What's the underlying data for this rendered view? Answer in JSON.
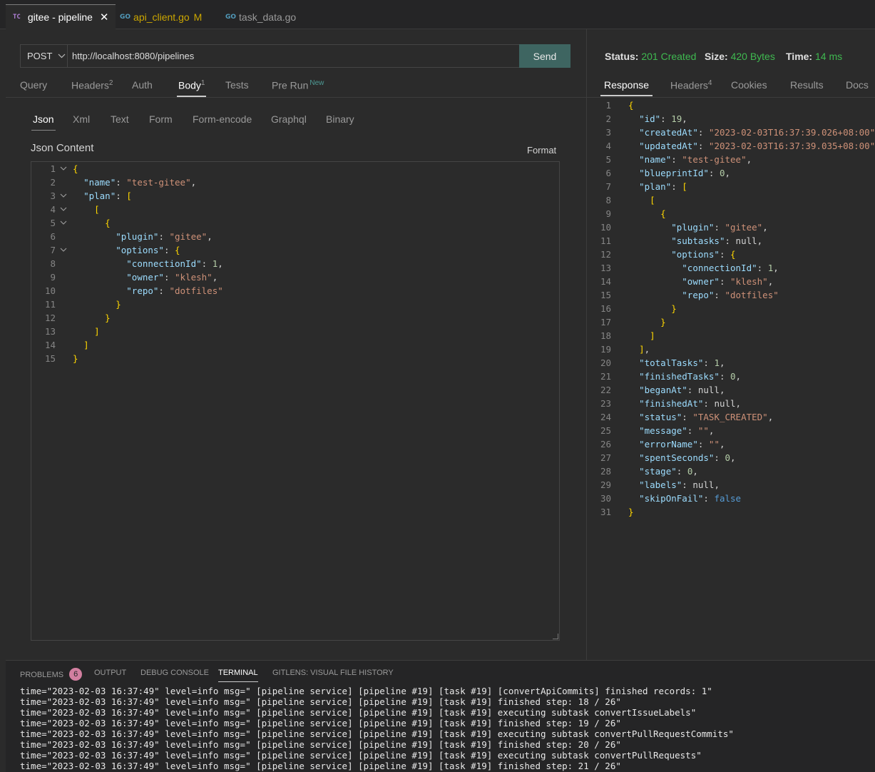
{
  "tabs": [
    {
      "label": "gitee - pipeline",
      "badge": "TC",
      "active": true
    },
    {
      "label": "api_client.go",
      "badge": "GO",
      "modified": "M"
    },
    {
      "label": "task_data.go",
      "badge": "GO"
    }
  ],
  "request": {
    "method": "POST",
    "url": "http://localhost:8080/pipelines",
    "send_label": "Send",
    "tabs": [
      {
        "label": "Query"
      },
      {
        "label": "Headers",
        "count": "2"
      },
      {
        "label": "Auth"
      },
      {
        "label": "Body",
        "count": "1",
        "active": true
      },
      {
        "label": "Tests"
      },
      {
        "label": "Pre Run",
        "tag": "New"
      }
    ],
    "body_tabs": [
      "Json",
      "Xml",
      "Text",
      "Form",
      "Form-encode",
      "Graphql",
      "Binary"
    ],
    "json_label": "Json Content",
    "format_label": "Format",
    "json_lines": [
      "{",
      "  \"name\": \"test-gitee\",",
      "  \"plan\": [",
      "    [",
      "      {",
      "        \"plugin\": \"gitee\",",
      "        \"options\": {",
      "          \"connectionId\": 1,",
      "          \"owner\": \"klesh\",",
      "          \"repo\": \"dotfiles\"",
      "        }",
      "      }",
      "    ]",
      "  ]",
      "}"
    ]
  },
  "response": {
    "status_label": "Status:",
    "status_value": "201 Created",
    "size_label": "Size:",
    "size_value": "420 Bytes",
    "time_label": "Time:",
    "time_value": "14 ms",
    "tabs": [
      {
        "label": "Response",
        "active": true
      },
      {
        "label": "Headers",
        "count": "4"
      },
      {
        "label": "Cookies"
      },
      {
        "label": "Results"
      },
      {
        "label": "Docs"
      }
    ],
    "json_lines": [
      "{",
      "  \"id\": 19,",
      "  \"createdAt\": \"2023-02-03T16:37:39.026+08:00\",",
      "  \"updatedAt\": \"2023-02-03T16:37:39.035+08:00\",",
      "  \"name\": \"test-gitee\",",
      "  \"blueprintId\": 0,",
      "  \"plan\": [",
      "    [",
      "      {",
      "        \"plugin\": \"gitee\",",
      "        \"subtasks\": null,",
      "        \"options\": {",
      "          \"connectionId\": 1,",
      "          \"owner\": \"klesh\",",
      "          \"repo\": \"dotfiles\"",
      "        }",
      "      }",
      "    ]",
      "  ],",
      "  \"totalTasks\": 1,",
      "  \"finishedTasks\": 0,",
      "  \"beganAt\": null,",
      "  \"finishedAt\": null,",
      "  \"status\": \"TASK_CREATED\",",
      "  \"message\": \"\",",
      "  \"errorName\": \"\",",
      "  \"spentSeconds\": 0,",
      "  \"stage\": 0,",
      "  \"labels\": null,",
      "  \"skipOnFail\": false",
      "}"
    ]
  },
  "panel": {
    "tabs": [
      {
        "label": "PROBLEMS",
        "badge": "6"
      },
      {
        "label": "OUTPUT"
      },
      {
        "label": "DEBUG CONSOLE"
      },
      {
        "label": "TERMINAL",
        "active": true
      },
      {
        "label": "GITLENS: VISUAL FILE HISTORY"
      }
    ],
    "terminal_lines": [
      "time=\"2023-02-03 16:37:49\" level=info msg=\" [pipeline service] [pipeline #19] [task #19] [convertApiCommits] finished records: 1\"",
      "time=\"2023-02-03 16:37:49\" level=info msg=\" [pipeline service] [pipeline #19] [task #19] finished step: 18 / 26\"",
      "time=\"2023-02-03 16:37:49\" level=info msg=\" [pipeline service] [pipeline #19] [task #19] executing subtask convertIssueLabels\"",
      "time=\"2023-02-03 16:37:49\" level=info msg=\" [pipeline service] [pipeline #19] [task #19] finished step: 19 / 26\"",
      "time=\"2023-02-03 16:37:49\" level=info msg=\" [pipeline service] [pipeline #19] [task #19] executing subtask convertPullRequestCommits\"",
      "time=\"2023-02-03 16:37:49\" level=info msg=\" [pipeline service] [pipeline #19] [task #19] finished step: 20 / 26\"",
      "time=\"2023-02-03 16:37:49\" level=info msg=\" [pipeline service] [pipeline #19] [task #19] executing subtask convertPullRequests\"",
      "time=\"2023-02-03 16:37:49\" level=info msg=\" [pipeline service] [pipeline #19] [task #19] finished step: 21 / 26\""
    ]
  },
  "colors": {
    "accent_send": "#3e6561",
    "status_ok": "#3fb950",
    "badge": "#d27fa0"
  }
}
